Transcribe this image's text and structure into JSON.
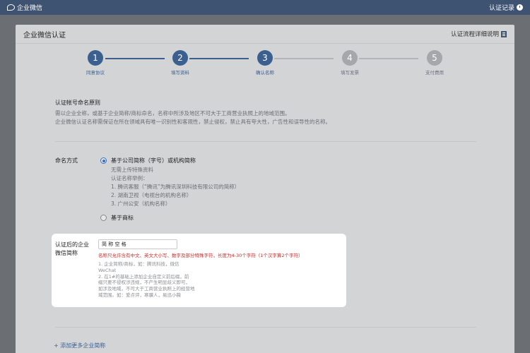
{
  "topbar": {
    "brand": "企业微信",
    "records": "认证记录"
  },
  "panel": {
    "title": "企业微信认证",
    "guide_link": "认证流程详细说明"
  },
  "steps": [
    {
      "number": "1",
      "label": "同意协议",
      "state": "active"
    },
    {
      "number": "2",
      "label": "填写资料",
      "state": "active"
    },
    {
      "number": "3",
      "label": "确认名称",
      "state": "active"
    },
    {
      "number": "4",
      "label": "填写发票",
      "state": "inactive"
    },
    {
      "number": "5",
      "label": "支付费用",
      "state": "inactive"
    }
  ],
  "rules": {
    "title": "认证帐号命名原则",
    "line1": "需以企业全称，或基于企业简称/商标命名，名称中所涉及地区不可大于工商营业执照上的地域范围。",
    "line2": "企业微信认证名称需保证在所在领域具有唯一识别性和客观性，禁止侵权，禁止具有夸大性，广告性和误导性的名称。"
  },
  "naming": {
    "label": "命名方式",
    "option1": {
      "title": "基于公司简称（字号）或机构简称",
      "details": [
        "无需上传特殊资料",
        "认证名称举例：",
        "1. 腾讯客服（“腾讯”为腾讯深圳科技有限公司的简称）",
        "2. 湖南卫视（电视台的机构名称）",
        "3. 广州公安（机构名称）"
      ]
    },
    "option2": {
      "title": "基于商标"
    }
  },
  "form": {
    "label_line1": "认证后的企业",
    "label_line2": "微信简称",
    "input_value": "简 称 空 格",
    "error": "名称只允许含有中文、英文大小写、数字及部分特殊字符，长度为4-30个字符（1个汉字算2个字符）",
    "hints": [
      "1. 企业简称/商标，如：腾讯科技，微信",
      "WeChat",
      "2. 在1#的基础上添加企业自定义前后缀，前",
      "缀只要不侵权涉违规，不产生明显歧义即可，",
      "如涉及地域，不可大于工商营业执照上的经营地",
      "域范围。如：爱点评，寒骥人，易迅小薇"
    ]
  },
  "add_more": "+ 添加更多企业简称"
}
